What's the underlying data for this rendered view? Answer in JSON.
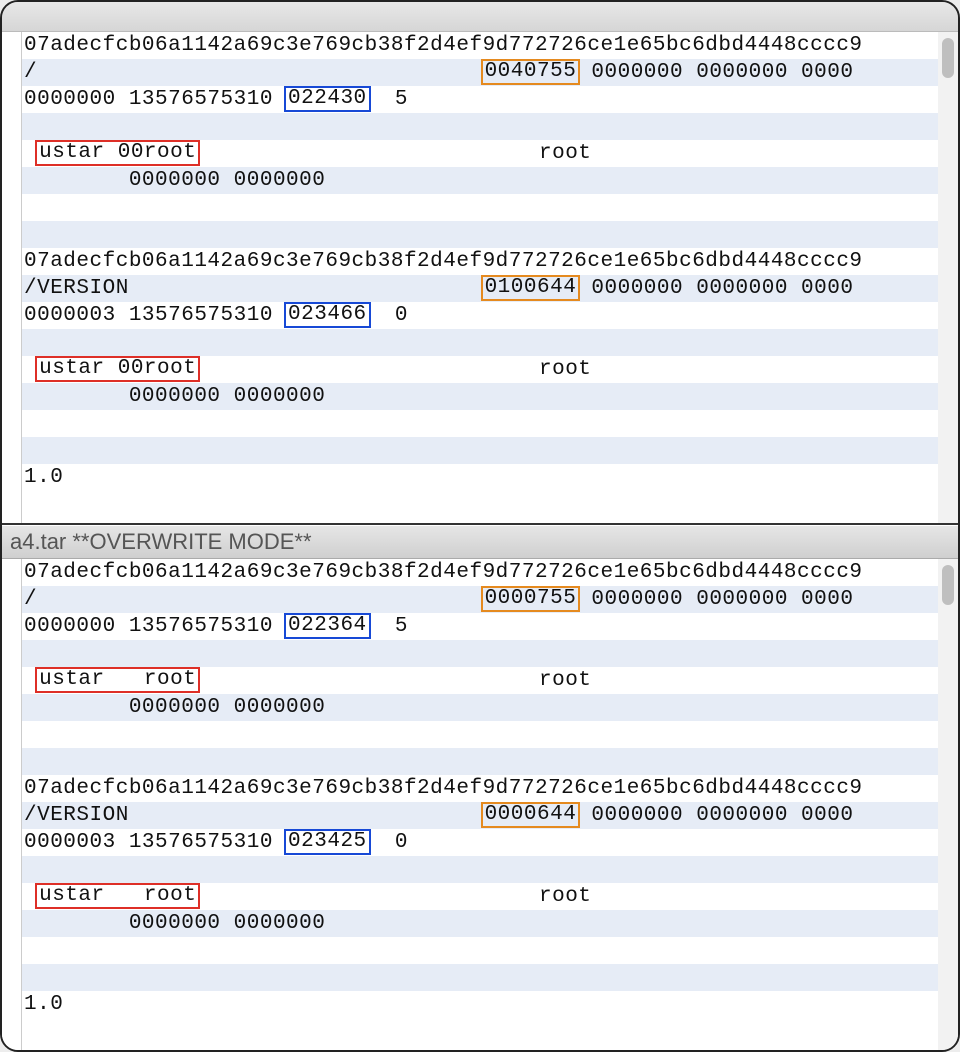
{
  "top": {
    "rows": [
      {
        "segments": [
          {
            "text": "07adecfcb06a1142a69c3e769cb38f2d4ef9d772726ce1e65bc6dbd4448cccc9"
          }
        ]
      },
      {
        "segments": [
          {
            "text": "/                                  "
          },
          {
            "text": "0040755",
            "box": "orange"
          },
          {
            "text": " 0000000 0000000 0000"
          }
        ]
      },
      {
        "segments": [
          {
            "text": "0000000 13576575310 "
          },
          {
            "text": "022430",
            "box": "blue"
          },
          {
            "text": "  5"
          }
        ]
      },
      {
        "segments": [
          {
            "text": ""
          }
        ]
      },
      {
        "segments": [
          {
            "text": " "
          },
          {
            "text": "ustar 00root",
            "box": "red"
          },
          {
            "text": "                          root"
          }
        ]
      },
      {
        "segments": [
          {
            "text": "        0000000 0000000"
          }
        ]
      },
      {
        "segments": [
          {
            "text": ""
          }
        ]
      },
      {
        "segments": [
          {
            "text": ""
          }
        ]
      },
      {
        "segments": [
          {
            "text": "07adecfcb06a1142a69c3e769cb38f2d4ef9d772726ce1e65bc6dbd4448cccc9"
          }
        ]
      },
      {
        "segments": [
          {
            "text": "/VERSION                           "
          },
          {
            "text": "0100644",
            "box": "orange"
          },
          {
            "text": " 0000000 0000000 0000"
          }
        ]
      },
      {
        "segments": [
          {
            "text": "0000003 13576575310 "
          },
          {
            "text": "023466",
            "box": "blue"
          },
          {
            "text": "  0"
          }
        ]
      },
      {
        "segments": [
          {
            "text": ""
          }
        ]
      },
      {
        "segments": [
          {
            "text": " "
          },
          {
            "text": "ustar 00root",
            "box": "red"
          },
          {
            "text": "                          root"
          }
        ]
      },
      {
        "segments": [
          {
            "text": "        0000000 0000000"
          }
        ]
      },
      {
        "segments": [
          {
            "text": ""
          }
        ]
      },
      {
        "segments": [
          {
            "text": ""
          }
        ]
      },
      {
        "segments": [
          {
            "text": "1.0"
          }
        ]
      }
    ]
  },
  "bottom_title": "a4.tar **OVERWRITE MODE**",
  "bottom": {
    "rows": [
      {
        "segments": [
          {
            "text": "07adecfcb06a1142a69c3e769cb38f2d4ef9d772726ce1e65bc6dbd4448cccc9"
          }
        ]
      },
      {
        "segments": [
          {
            "text": "/                                  "
          },
          {
            "text": "0000755",
            "box": "orange"
          },
          {
            "text": " 0000000 0000000 0000"
          }
        ]
      },
      {
        "segments": [
          {
            "text": "0000000 13576575310 "
          },
          {
            "text": "022364",
            "box": "blue"
          },
          {
            "text": "  5"
          }
        ]
      },
      {
        "segments": [
          {
            "text": ""
          }
        ]
      },
      {
        "segments": [
          {
            "text": " "
          },
          {
            "text": "ustar   root",
            "box": "red"
          },
          {
            "text": "                          root"
          }
        ]
      },
      {
        "segments": [
          {
            "text": "        0000000 0000000"
          }
        ]
      },
      {
        "segments": [
          {
            "text": ""
          }
        ]
      },
      {
        "segments": [
          {
            "text": ""
          }
        ]
      },
      {
        "segments": [
          {
            "text": "07adecfcb06a1142a69c3e769cb38f2d4ef9d772726ce1e65bc6dbd4448cccc9"
          }
        ]
      },
      {
        "segments": [
          {
            "text": "/VERSION                           "
          },
          {
            "text": "0000644",
            "box": "orange"
          },
          {
            "text": " 0000000 0000000 0000"
          }
        ]
      },
      {
        "segments": [
          {
            "text": "0000003 13576575310 "
          },
          {
            "text": "023425",
            "box": "blue"
          },
          {
            "text": "  0"
          }
        ]
      },
      {
        "segments": [
          {
            "text": ""
          }
        ]
      },
      {
        "segments": [
          {
            "text": " "
          },
          {
            "text": "ustar   root",
            "box": "red"
          },
          {
            "text": "                          root"
          }
        ]
      },
      {
        "segments": [
          {
            "text": "        0000000 0000000"
          }
        ]
      },
      {
        "segments": [
          {
            "text": ""
          }
        ]
      },
      {
        "segments": [
          {
            "text": ""
          }
        ]
      },
      {
        "segments": [
          {
            "text": "1.0"
          }
        ]
      }
    ]
  }
}
